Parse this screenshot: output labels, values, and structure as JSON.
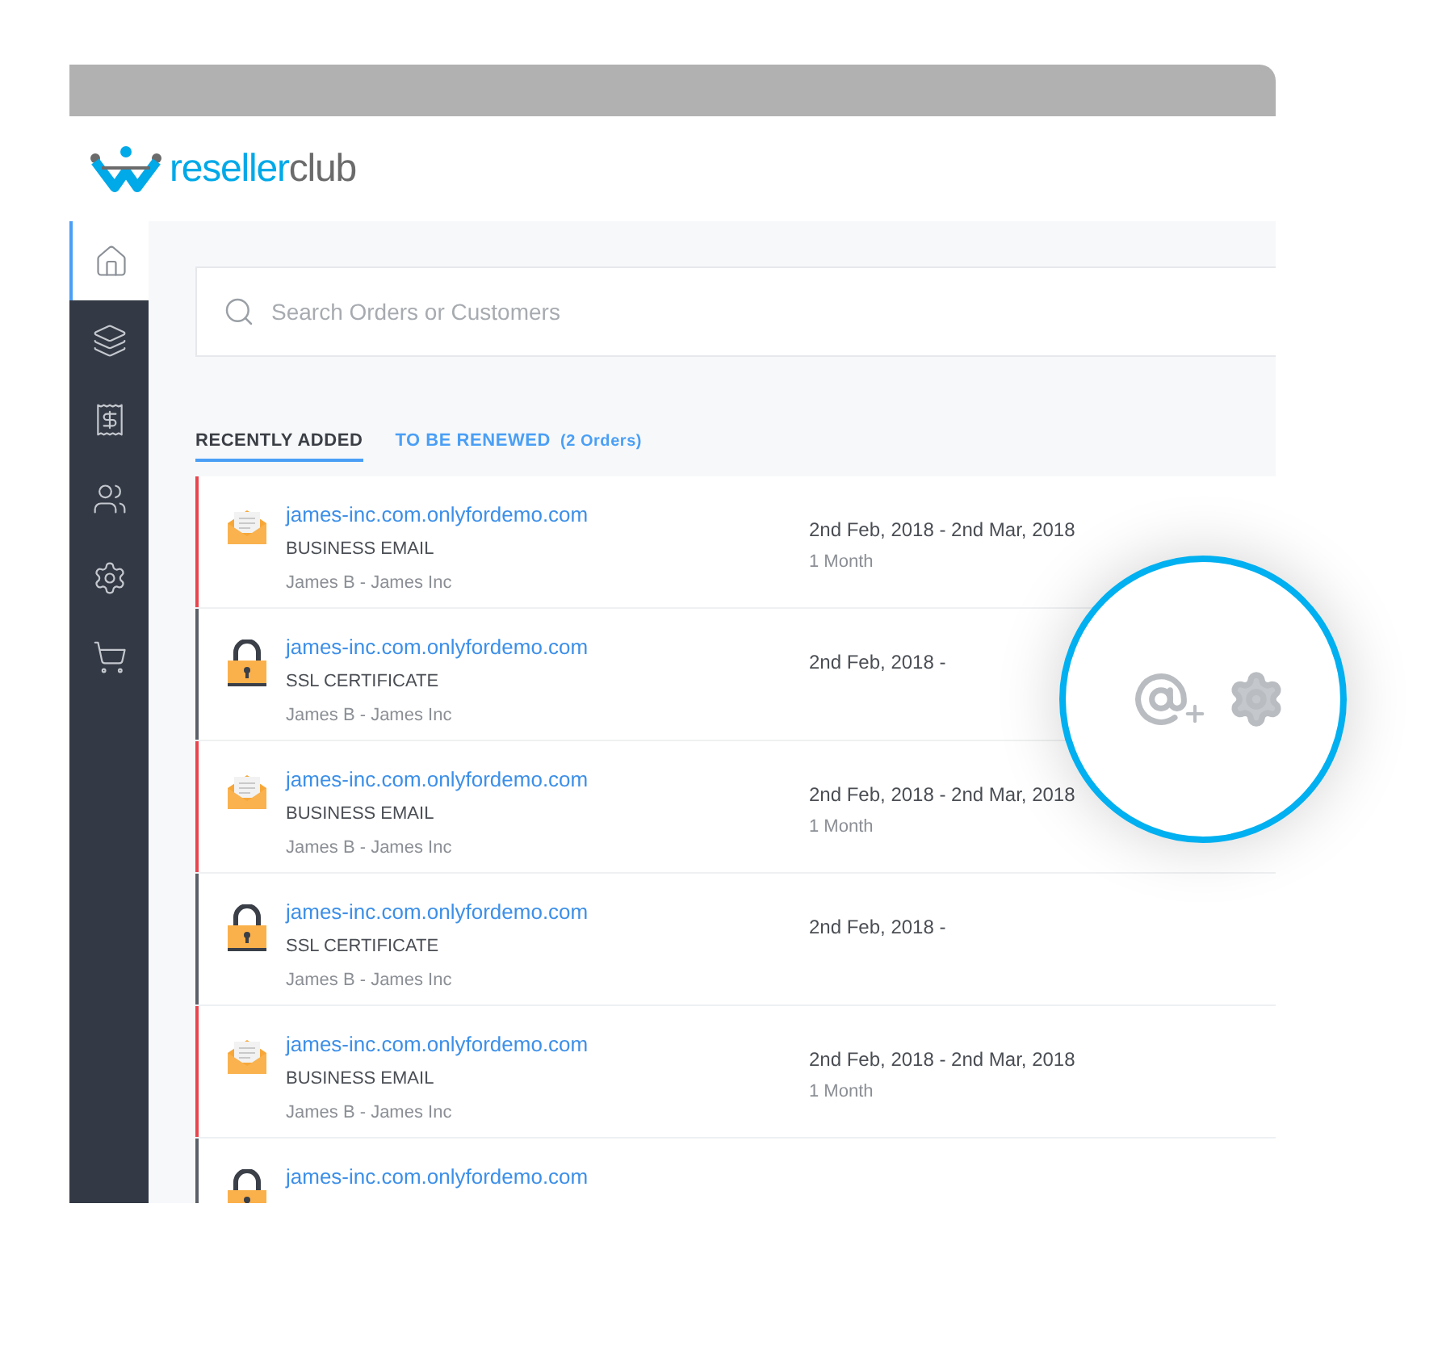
{
  "brand": {
    "name_part_1": "reseller",
    "name_part_2": "club"
  },
  "sidebar": {
    "items": [
      {
        "selected": true
      },
      {
        "selected": false
      },
      {
        "selected": false
      },
      {
        "selected": false
      },
      {
        "selected": false
      },
      {
        "selected": false
      }
    ]
  },
  "search": {
    "placeholder": "Search Orders or Customers"
  },
  "tabs": [
    {
      "label": "RECENTLY ADDED",
      "selected": true
    },
    {
      "label": "TO BE RENEWED",
      "count": "(2 Orders)",
      "selected": false
    }
  ],
  "orders": [
    {
      "kind": "email",
      "domain": "james-inc.com.onlyfordemo.com",
      "product": "BUSINESS EMAIL",
      "customer": "James B - James Inc",
      "dates": "2nd Feb, 2018 - 2nd Mar, 2018",
      "term": "1 Month"
    },
    {
      "kind": "ssl",
      "domain": "james-inc.com.onlyfordemo.com",
      "product": "SSL CERTIFICATE",
      "customer": "James B - James Inc",
      "dates": "2nd Feb, 2018 -"
    },
    {
      "kind": "email",
      "domain": "james-inc.com.onlyfordemo.com",
      "product": "BUSINESS EMAIL",
      "customer": "James B - James Inc",
      "dates": "2nd Feb, 2018 - 2nd Mar, 2018",
      "term": "1 Month"
    },
    {
      "kind": "ssl",
      "domain": "james-inc.com.onlyfordemo.com",
      "product": "SSL CERTIFICATE",
      "customer": "James B - James Inc",
      "dates": "2nd Feb, 2018 -"
    },
    {
      "kind": "email",
      "domain": "james-inc.com.onlyfordemo.com",
      "product": "BUSINESS EMAIL",
      "customer": "James B - James Inc",
      "dates": "2nd Feb, 2018 - 2nd Mar, 2018",
      "term": "1 Month"
    },
    {
      "kind": "ssl",
      "domain": "james-inc.com.onlyfordemo.com"
    }
  ]
}
